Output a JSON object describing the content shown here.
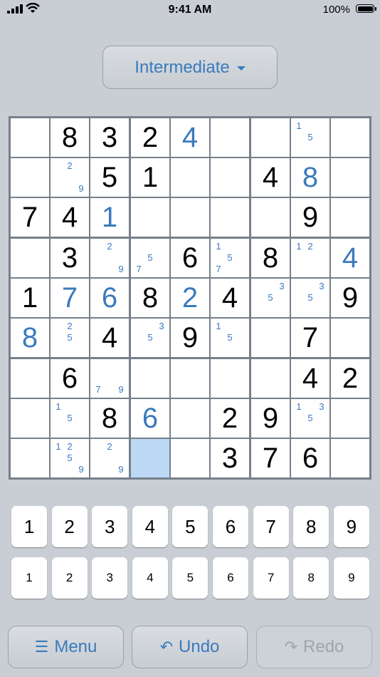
{
  "status": {
    "time": "9:41 AM",
    "battery": "100%"
  },
  "difficulty": {
    "label": "Intermediate",
    "icon": "chevron-down-icon"
  },
  "board": {
    "cells": [
      [
        {
          "v": "",
          "t": ""
        },
        {
          "v": "8",
          "t": "given"
        },
        {
          "v": "3",
          "t": "given"
        },
        {
          "v": "2",
          "t": "given"
        },
        {
          "v": "4",
          "t": "entered"
        },
        {
          "v": "",
          "t": ""
        },
        {
          "v": "",
          "t": ""
        },
        {
          "v": "",
          "t": "",
          "n": [
            1,
            5
          ]
        },
        {
          "v": "",
          "t": ""
        }
      ],
      [
        {
          "v": "",
          "t": ""
        },
        {
          "v": "",
          "t": "",
          "n": [
            2,
            9
          ]
        },
        {
          "v": "5",
          "t": "given"
        },
        {
          "v": "1",
          "t": "given"
        },
        {
          "v": "",
          "t": ""
        },
        {
          "v": "",
          "t": ""
        },
        {
          "v": "4",
          "t": "given"
        },
        {
          "v": "8",
          "t": "entered"
        },
        {
          "v": "",
          "t": ""
        }
      ],
      [
        {
          "v": "7",
          "t": "given"
        },
        {
          "v": "4",
          "t": "given"
        },
        {
          "v": "1",
          "t": "entered"
        },
        {
          "v": "",
          "t": ""
        },
        {
          "v": "",
          "t": ""
        },
        {
          "v": "",
          "t": ""
        },
        {
          "v": "",
          "t": ""
        },
        {
          "v": "9",
          "t": "given"
        },
        {
          "v": "",
          "t": ""
        }
      ],
      [
        {
          "v": "",
          "t": ""
        },
        {
          "v": "3",
          "t": "given"
        },
        {
          "v": "",
          "t": "",
          "n": [
            2,
            9
          ]
        },
        {
          "v": "",
          "t": "",
          "n": [
            5,
            7
          ]
        },
        {
          "v": "6",
          "t": "given"
        },
        {
          "v": "",
          "t": "",
          "n": [
            1,
            5,
            7
          ]
        },
        {
          "v": "8",
          "t": "given"
        },
        {
          "v": "",
          "t": "",
          "n": [
            1,
            2
          ]
        },
        {
          "v": "4",
          "t": "entered"
        }
      ],
      [
        {
          "v": "1",
          "t": "given"
        },
        {
          "v": "7",
          "t": "entered"
        },
        {
          "v": "6",
          "t": "entered"
        },
        {
          "v": "8",
          "t": "given"
        },
        {
          "v": "2",
          "t": "entered"
        },
        {
          "v": "4",
          "t": "given"
        },
        {
          "v": "",
          "t": "",
          "n": [
            3,
            5
          ]
        },
        {
          "v": "",
          "t": "",
          "n": [
            3,
            5
          ]
        },
        {
          "v": "9",
          "t": "given"
        }
      ],
      [
        {
          "v": "8",
          "t": "entered"
        },
        {
          "v": "",
          "t": "",
          "n": [
            2,
            5
          ]
        },
        {
          "v": "4",
          "t": "given"
        },
        {
          "v": "",
          "t": "",
          "n": [
            3,
            5
          ]
        },
        {
          "v": "9",
          "t": "given"
        },
        {
          "v": "",
          "t": "",
          "n": [
            1,
            5
          ]
        },
        {
          "v": "",
          "t": ""
        },
        {
          "v": "7",
          "t": "given"
        },
        {
          "v": "",
          "t": ""
        }
      ],
      [
        {
          "v": "",
          "t": ""
        },
        {
          "v": "6",
          "t": "given"
        },
        {
          "v": "",
          "t": "",
          "n": [
            7,
            9
          ]
        },
        {
          "v": "",
          "t": ""
        },
        {
          "v": "",
          "t": ""
        },
        {
          "v": "",
          "t": ""
        },
        {
          "v": "",
          "t": ""
        },
        {
          "v": "4",
          "t": "given"
        },
        {
          "v": "2",
          "t": "given"
        }
      ],
      [
        {
          "v": "",
          "t": ""
        },
        {
          "v": "",
          "t": "",
          "n": [
            1,
            5
          ]
        },
        {
          "v": "8",
          "t": "given"
        },
        {
          "v": "6",
          "t": "entered"
        },
        {
          "v": "",
          "t": ""
        },
        {
          "v": "2",
          "t": "given"
        },
        {
          "v": "9",
          "t": "given"
        },
        {
          "v": "",
          "t": "",
          "n": [
            1,
            3,
            5
          ]
        },
        {
          "v": "",
          "t": ""
        }
      ],
      [
        {
          "v": "",
          "t": ""
        },
        {
          "v": "",
          "t": "",
          "n": [
            1,
            2,
            5,
            9
          ]
        },
        {
          "v": "",
          "t": "",
          "n": [
            2,
            9
          ]
        },
        {
          "v": "",
          "t": "selected"
        },
        {
          "v": "",
          "t": ""
        },
        {
          "v": "3",
          "t": "given"
        },
        {
          "v": "7",
          "t": "given"
        },
        {
          "v": "6",
          "t": "given"
        },
        {
          "v": "",
          "t": ""
        }
      ]
    ]
  },
  "keypad": {
    "numbers": [
      "1",
      "2",
      "3",
      "4",
      "5",
      "6",
      "7",
      "8",
      "9"
    ],
    "notes": [
      "1",
      "2",
      "3",
      "4",
      "5",
      "6",
      "7",
      "8",
      "9"
    ]
  },
  "toolbar": {
    "menu": {
      "label": "Menu",
      "icon": "menu-icon"
    },
    "undo": {
      "label": "Undo",
      "icon": "undo-icon"
    },
    "redo": {
      "label": "Redo",
      "icon": "redo-icon",
      "disabled": true
    }
  },
  "colors": {
    "accent": "#3a7abd",
    "selected": "#bcd8f5",
    "background": "#c9ced4"
  }
}
